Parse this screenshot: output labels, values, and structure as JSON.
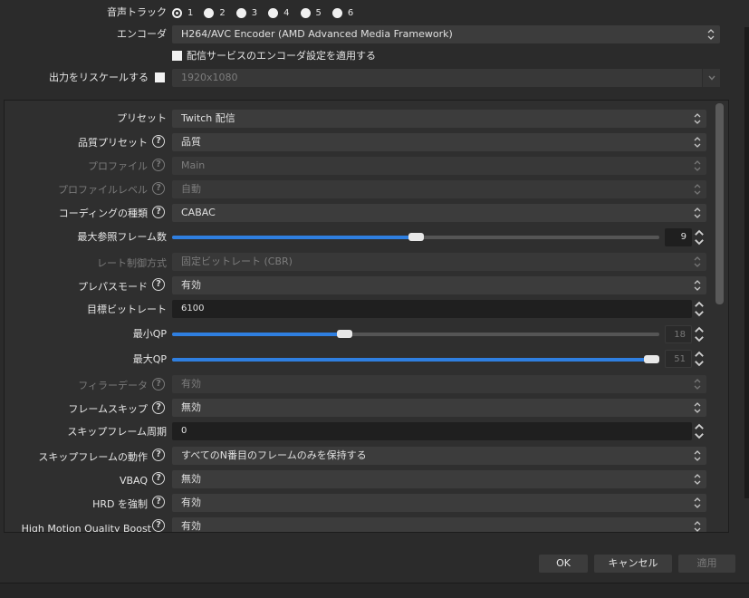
{
  "audio_track": {
    "label": "音声トラック",
    "options": [
      "1",
      "2",
      "3",
      "4",
      "5",
      "6"
    ],
    "selected": "1"
  },
  "encoder": {
    "label": "エンコーダ",
    "value": "H264/AVC Encoder (AMD Advanced Media Framework)"
  },
  "enforce_service_settings": {
    "label": "配信サービスのエンコーダ設定を適用する",
    "checked": false
  },
  "rescale": {
    "label": "出力をリスケールする",
    "checked": false,
    "value": "1920x1080"
  },
  "settings": {
    "preset": {
      "label": "プリセット",
      "value": "Twitch 配信"
    },
    "quality_preset": {
      "label": "品質プリセット",
      "value": "品質"
    },
    "profile": {
      "label": "プロファイル",
      "value": "Main"
    },
    "profile_level": {
      "label": "プロファイルレベル",
      "value": "自動"
    },
    "coding_type": {
      "label": "コーディングの種類",
      "value": "CABAC"
    },
    "max_ref_frames": {
      "label": "最大参照フレーム数",
      "value": "9",
      "fraction": 0.5
    },
    "rate_control": {
      "label": "レート制御方式",
      "value": "固定ビットレート (CBR)"
    },
    "prepass_mode": {
      "label": "プレパスモード",
      "value": "有効"
    },
    "target_bitrate": {
      "label": "目標ビットレート",
      "value": "6100"
    },
    "min_qp": {
      "label": "最小QP",
      "value": "18",
      "fraction": 0.35
    },
    "max_qp": {
      "label": "最大QP",
      "value": "51",
      "fraction": 1.0
    },
    "filler_data": {
      "label": "フィラーデータ",
      "value": "有効"
    },
    "frame_skip": {
      "label": "フレームスキップ",
      "value": "無効"
    },
    "skip_frame_period": {
      "label": "スキップフレーム周期",
      "value": "0"
    },
    "skip_frame_behavior": {
      "label": "スキップフレームの動作",
      "value": "すべてのN番目のフレームのみを保持する"
    },
    "vbaq": {
      "label": "VBAQ",
      "value": "無効"
    },
    "enforce_hrd": {
      "label": "HRD を強制",
      "value": "有効"
    },
    "high_motion_quality_boost": {
      "label": "High Motion Quality Boost",
      "value": "有効"
    }
  },
  "buttons": {
    "ok": "OK",
    "cancel": "キャンセル",
    "apply": "適用"
  },
  "colors": {
    "accent": "#2f7fe0",
    "background": "#2b2b2b",
    "field": "#3c3c3c"
  }
}
